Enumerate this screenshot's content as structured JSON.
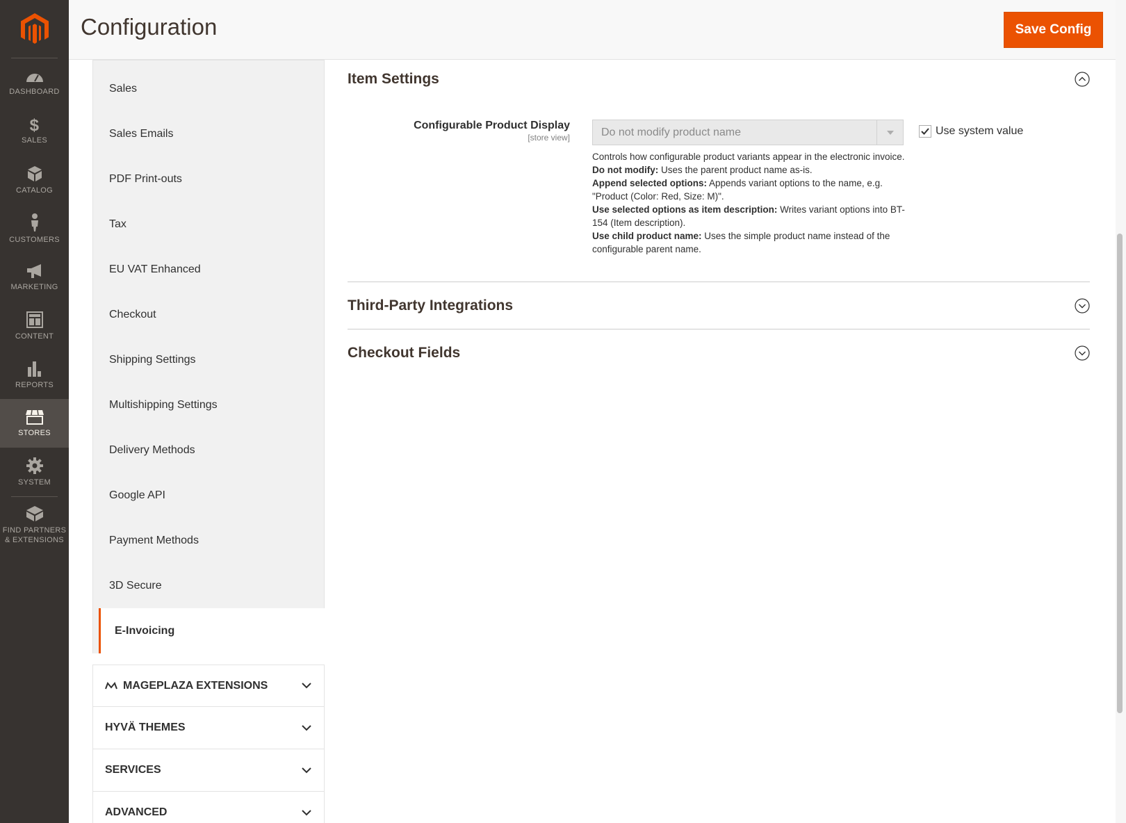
{
  "admin_nav": {
    "items": [
      {
        "label": "DASHBOARD",
        "icon": "dashboard-icon"
      },
      {
        "label": "SALES",
        "icon": "dollar-icon"
      },
      {
        "label": "CATALOG",
        "icon": "cube-icon"
      },
      {
        "label": "CUSTOMERS",
        "icon": "person-icon"
      },
      {
        "label": "MARKETING",
        "icon": "megaphone-icon"
      },
      {
        "label": "CONTENT",
        "icon": "layout-icon"
      },
      {
        "label": "REPORTS",
        "icon": "bar-chart-icon"
      },
      {
        "label": "STORES",
        "icon": "storefront-icon"
      },
      {
        "label": "SYSTEM",
        "icon": "gear-icon"
      }
    ],
    "partners_label_1": "FIND PARTNERS",
    "partners_label_2": "& EXTENSIONS"
  },
  "header": {
    "title": "Configuration",
    "save_label": "Save Config"
  },
  "config_sidebar": {
    "sections": [
      "Sales",
      "Sales Emails",
      "PDF Print-outs",
      "Tax",
      "EU VAT Enhanced",
      "Checkout",
      "Shipping Settings",
      "Multishipping Settings",
      "Delivery Methods",
      "Google API",
      "Payment Methods",
      "3D Secure"
    ],
    "active_section": "E-Invoicing",
    "groups": [
      "MAGEPLAZA EXTENSIONS",
      "HYVÄ THEMES",
      "SERVICES",
      "ADVANCED"
    ]
  },
  "main": {
    "item_settings_title": "Item Settings",
    "field": {
      "label": "Configurable Product Display",
      "scope": "[store view]",
      "selected": "Do not modify product name",
      "use_system_value": "Use system value",
      "use_system_checked": true,
      "note_intro": "Controls how configurable product variants appear in the electronic invoice.",
      "note_1_b": "Do not modify:",
      "note_1": " Uses the parent product name as-is.",
      "note_2_b": "Append selected options:",
      "note_2": " Appends variant options to the name, e.g. \"Product (Color: Red, Size: M)\".",
      "note_3_b": "Use selected options as item description:",
      "note_3": " Writes variant options into BT-154 (Item description).",
      "note_4_b": "Use child product name:",
      "note_4": " Uses the simple product name instead of the configurable parent name."
    },
    "third_party_title": "Third-Party Integrations",
    "checkout_fields_title": "Checkout Fields"
  },
  "colors": {
    "accent": "#eb5202",
    "nav_bg": "#373330"
  }
}
